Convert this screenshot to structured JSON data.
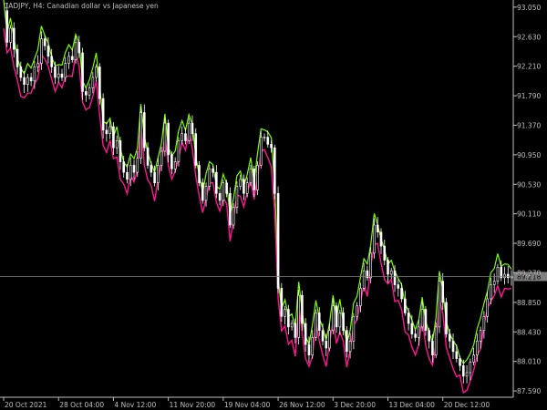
{
  "header": {
    "symbol": "CADJPY,",
    "timeframe": "H4:",
    "description": "Canadian dollar vs Japanese yen"
  },
  "colors": {
    "background": "#000000",
    "axis": "#c0c0c0",
    "upper_band": "#7cff00",
    "lower_band": "#ff1493",
    "candles": "#ffffff",
    "price_line": "#808080",
    "price_box": "#808080"
  },
  "current_price": {
    "label": "89.218",
    "value": 89.218
  },
  "chart_data": {
    "type": "line",
    "title": "",
    "xlabel": "",
    "ylabel": "",
    "grid": false,
    "ylim": [
      87.5,
      93.1
    ],
    "y_ticks": [
      "93.050",
      "92.630",
      "92.210",
      "91.790",
      "91.370",
      "90.950",
      "90.530",
      "90.110",
      "89.690",
      "89.270",
      "88.850",
      "88.430",
      "88.010",
      "87.590"
    ],
    "y_tick_values": [
      93.05,
      92.63,
      92.21,
      91.79,
      91.37,
      90.95,
      90.53,
      90.11,
      89.69,
      89.27,
      88.85,
      88.43,
      88.01,
      87.59
    ],
    "x_ticks": [
      "20 Oct 2021",
      "28 Oct 04:00",
      "4 Nov 12:00",
      "11 Nov 20:00",
      "19 Nov 04:00",
      "26 Nov 12:00",
      "3 Dec 20:00",
      "13 Dec 04:00",
      "20 Dec 12:00"
    ],
    "x_tick_bar_index": [
      0,
      16,
      32,
      48,
      64,
      80,
      96,
      112,
      128
    ],
    "series": [
      {
        "values": [
          93.0,
          92.55,
          92.75,
          92.45,
          92.2,
          92.05,
          91.95,
          92.05,
          92.0,
          92.2,
          92.25,
          92.6,
          92.5,
          92.35,
          92.2,
          92.05,
          92.1,
          92.05,
          92.25,
          92.35,
          92.3,
          92.55,
          92.4,
          91.85,
          91.8,
          91.9,
          92.05,
          92.2,
          91.75,
          91.3,
          91.25,
          91.35,
          91.05,
          91.15,
          90.85,
          90.7,
          90.6,
          90.8,
          90.7,
          90.9,
          91.55,
          91.05,
          90.8,
          90.7,
          90.55,
          90.8,
          91.0,
          91.4,
          90.95,
          90.75,
          90.85,
          91.15,
          91.25,
          91.15,
          91.4,
          91.25,
          90.8,
          90.55,
          90.3,
          90.5,
          90.75,
          90.7,
          90.4,
          90.3,
          90.55,
          90.4,
          89.95,
          90.2,
          90.5,
          90.6,
          90.4,
          90.55,
          90.75,
          90.45,
          90.8,
          91.2,
          91.2,
          91.1,
          91.05,
          90.4,
          89.05,
          88.65,
          88.75,
          88.5,
          88.55,
          88.35,
          88.95,
          88.55,
          88.25,
          88.1,
          88.35,
          88.7,
          88.45,
          88.3,
          88.2,
          88.45,
          88.8,
          88.5,
          88.7,
          88.45,
          88.15,
          88.3,
          88.65,
          88.8,
          89.05,
          89.3,
          89.2,
          89.55,
          89.95,
          89.85,
          89.65,
          89.45,
          89.25,
          89.3,
          89.1,
          89.05,
          88.9,
          88.7,
          88.55,
          88.4,
          88.35,
          88.5,
          88.75,
          88.45,
          88.3,
          88.1,
          88.5,
          89.15,
          88.85,
          88.4,
          88.3,
          88.15,
          88.05,
          87.95,
          87.8,
          87.85,
          88.0,
          88.1,
          88.3,
          88.45,
          88.65,
          88.9,
          89.1,
          89.15,
          89.35,
          89.2,
          89.25,
          89.2,
          89.22
        ]
      }
    ]
  }
}
